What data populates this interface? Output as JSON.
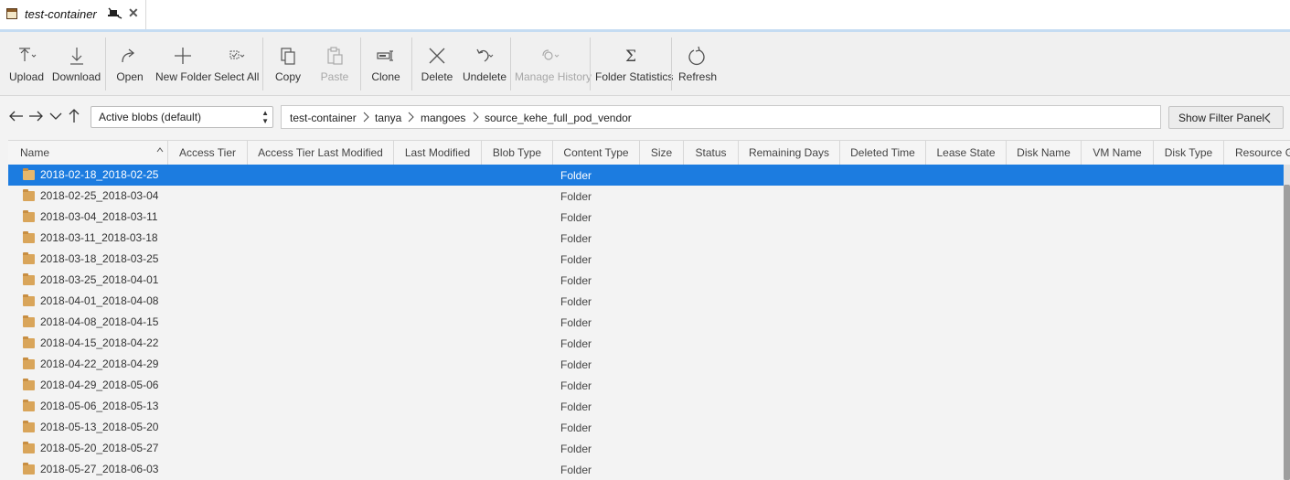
{
  "tab": {
    "title": "test-container"
  },
  "toolbar": {
    "upload": "Upload",
    "download": "Download",
    "open": "Open",
    "new_folder": "New Folder",
    "select_all": "Select All",
    "copy": "Copy",
    "paste": "Paste",
    "clone": "Clone",
    "delete": "Delete",
    "undelete": "Undelete",
    "manage_history": "Manage History",
    "folder_statistics": "Folder Statistics",
    "refresh": "Refresh"
  },
  "view_select": {
    "value": "Active blobs (default)"
  },
  "breadcrumb": [
    "test-container",
    "tanya",
    "mangoes",
    "source_kehe_full_pod_vendor"
  ],
  "filter_button": "Show Filter Panel",
  "columns": [
    "Name",
    "Access Tier",
    "Access Tier Last Modified",
    "Last Modified",
    "Blob Type",
    "Content Type",
    "Size",
    "Status",
    "Remaining Days",
    "Deleted Time",
    "Lease State",
    "Disk Name",
    "VM Name",
    "Disk Type",
    "Resource G"
  ],
  "rows": [
    {
      "name": "2018-02-18_2018-02-25",
      "content_type": "Folder",
      "selected": true
    },
    {
      "name": "2018-02-25_2018-03-04",
      "content_type": "Folder"
    },
    {
      "name": "2018-03-04_2018-03-11",
      "content_type": "Folder"
    },
    {
      "name": "2018-03-11_2018-03-18",
      "content_type": "Folder"
    },
    {
      "name": "2018-03-18_2018-03-25",
      "content_type": "Folder"
    },
    {
      "name": "2018-03-25_2018-04-01",
      "content_type": "Folder"
    },
    {
      "name": "2018-04-01_2018-04-08",
      "content_type": "Folder"
    },
    {
      "name": "2018-04-08_2018-04-15",
      "content_type": "Folder"
    },
    {
      "name": "2018-04-15_2018-04-22",
      "content_type": "Folder"
    },
    {
      "name": "2018-04-22_2018-04-29",
      "content_type": "Folder"
    },
    {
      "name": "2018-04-29_2018-05-06",
      "content_type": "Folder"
    },
    {
      "name": "2018-05-06_2018-05-13",
      "content_type": "Folder"
    },
    {
      "name": "2018-05-13_2018-05-20",
      "content_type": "Folder"
    },
    {
      "name": "2018-05-20_2018-05-27",
      "content_type": "Folder"
    },
    {
      "name": "2018-05-27_2018-06-03",
      "content_type": "Folder"
    }
  ]
}
